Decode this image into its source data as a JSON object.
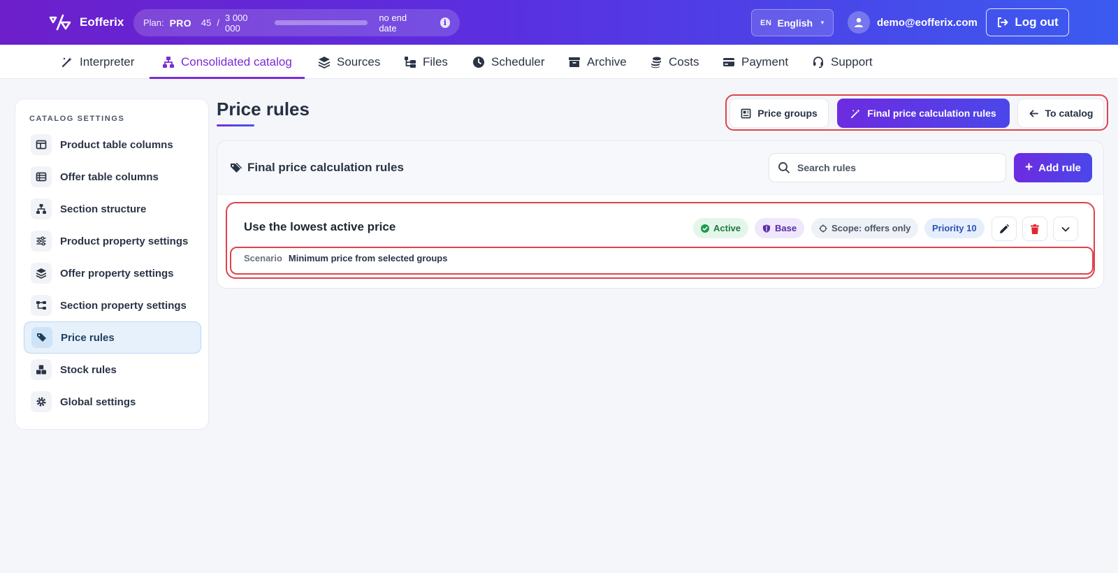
{
  "brand": {
    "name": "Eofferix"
  },
  "plan": {
    "label": "Plan:",
    "name": "PRO",
    "usage_used": "45",
    "usage_sep": "/",
    "usage_limit": "3 000 000",
    "usage_fraction": 1.5e-05,
    "expiry": "no end date"
  },
  "language": {
    "code": "EN",
    "name": "English"
  },
  "user": {
    "email": "demo@eofferix.com"
  },
  "logout_label": "Log out",
  "nav": {
    "items": [
      {
        "label": "Interpreter",
        "icon": "magic-wand-icon"
      },
      {
        "label": "Consolidated catalog",
        "icon": "sitemap-icon",
        "active": true
      },
      {
        "label": "Sources",
        "icon": "layers-icon"
      },
      {
        "label": "Files",
        "icon": "folder-tree-icon"
      },
      {
        "label": "Scheduler",
        "icon": "clock-icon"
      },
      {
        "label": "Archive",
        "icon": "archive-icon"
      },
      {
        "label": "Costs",
        "icon": "coins-icon"
      },
      {
        "label": "Payment",
        "icon": "credit-card-icon"
      },
      {
        "label": "Support",
        "icon": "headset-icon"
      }
    ]
  },
  "sidebar": {
    "title": "CATALOG SETTINGS",
    "items": [
      {
        "label": "Product table columns",
        "icon": "columns-icon"
      },
      {
        "label": "Offer table columns",
        "icon": "table-icon"
      },
      {
        "label": "Section structure",
        "icon": "sitemap-icon"
      },
      {
        "label": "Product property settings",
        "icon": "sliders-icon"
      },
      {
        "label": "Offer property settings",
        "icon": "layers-icon"
      },
      {
        "label": "Section property settings",
        "icon": "diagram-icon"
      },
      {
        "label": "Price rules",
        "icon": "tags-icon",
        "active": true
      },
      {
        "label": "Stock rules",
        "icon": "boxes-icon"
      },
      {
        "label": "Global settings",
        "icon": "gear-icon"
      }
    ]
  },
  "page": {
    "title": "Price rules"
  },
  "tabs": {
    "price_groups": "Price groups",
    "final_rules": "Final price calculation rules",
    "to_catalog": "To catalog"
  },
  "panel": {
    "title": "Final price calculation rules",
    "search_placeholder": "Search rules",
    "add_label": "Add rule"
  },
  "rule": {
    "name": "Use the lowest active price",
    "status": "Active",
    "type": "Base",
    "scope": "Scope: offers only",
    "priority": "Priority 10",
    "scenario_label": "Scenario",
    "scenario_value": "Minimum price from selected groups"
  },
  "colors": {
    "accent": "#7b2bd6",
    "highlight_outline": "#e0424c",
    "delete": "#e0262f"
  }
}
